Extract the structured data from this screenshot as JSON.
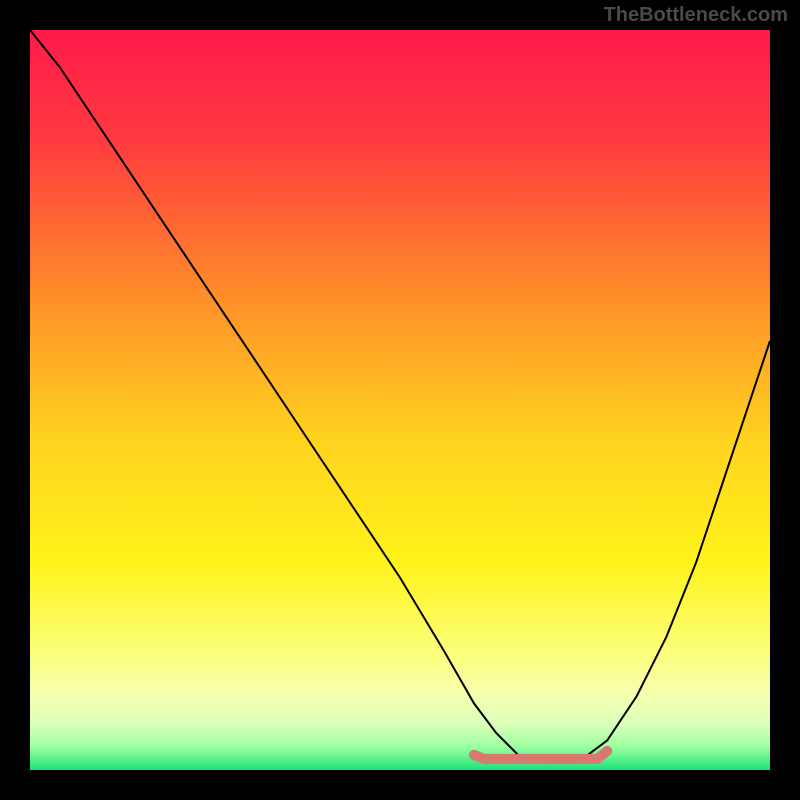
{
  "watermark": "TheBottleneck.com",
  "chart_data": {
    "type": "line",
    "title": "",
    "xlabel": "",
    "ylabel": "",
    "xlim": [
      0,
      100
    ],
    "ylim": [
      0,
      100
    ],
    "background_gradient": {
      "stops": [
        {
          "offset": 0.0,
          "color": "#ff1a4b"
        },
        {
          "offset": 0.15,
          "color": "#ff3b3f"
        },
        {
          "offset": 0.35,
          "color": "#ff8a2a"
        },
        {
          "offset": 0.55,
          "color": "#ffd21f"
        },
        {
          "offset": 0.72,
          "color": "#fff31a"
        },
        {
          "offset": 0.84,
          "color": "#fbff7a"
        },
        {
          "offset": 0.9,
          "color": "#f5ffb0"
        },
        {
          "offset": 0.94,
          "color": "#d8ffb8"
        },
        {
          "offset": 0.97,
          "color": "#97ff9e"
        },
        {
          "offset": 1.0,
          "color": "#1de27a"
        }
      ]
    },
    "series": [
      {
        "name": "bottleneck-curve",
        "color": "#000000",
        "x": [
          0,
          4,
          10,
          18,
          26,
          34,
          42,
          50,
          56,
          60,
          63,
          66,
          70,
          74,
          78,
          82,
          86,
          90,
          94,
          98,
          100
        ],
        "y": [
          100,
          95,
          86,
          74,
          62,
          50,
          38,
          26,
          16,
          9,
          5,
          2,
          1,
          1,
          4,
          10,
          18,
          28,
          40,
          52,
          58
        ]
      }
    ],
    "highlight_band": {
      "name": "optimal-range",
      "color": "#d9786f",
      "x_start": 60,
      "x_end": 78,
      "y": 1.5
    }
  }
}
